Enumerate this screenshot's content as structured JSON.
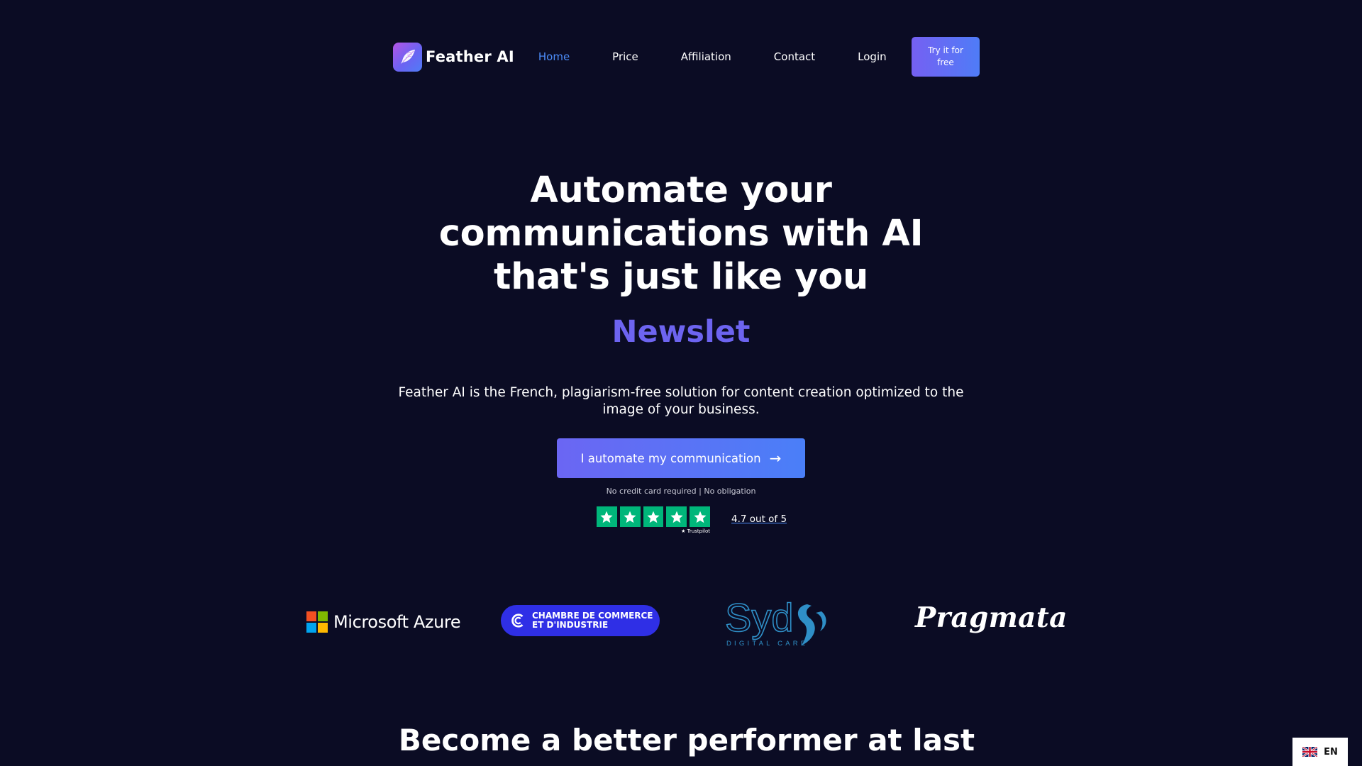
{
  "nav": {
    "brand_name": "Feather AI",
    "brand_icon": "feather-icon",
    "links": [
      {
        "label": "Home",
        "active": true
      },
      {
        "label": "Price",
        "active": false
      },
      {
        "label": "Affiliation",
        "active": false
      },
      {
        "label": "Contact",
        "active": false
      },
      {
        "label": "Login",
        "active": false
      }
    ],
    "cta_label": "Try it for free"
  },
  "hero": {
    "title": "Automate your communications with AI that's just like you",
    "typed_word": "Newslet",
    "description": "Feather AI is the French, plagiarism-free solution for content creation optimized to the image of your business.",
    "cta_label": "I automate my communication",
    "cta_icon": "arrow-right-icon",
    "note": "No credit card required | No obligation"
  },
  "rating": {
    "stars": 5,
    "provider": "Trustpilot",
    "text": "4.7 out of 5"
  },
  "partners": {
    "azure": "Microsoft Azure",
    "cci_line1": "CHAMBRE DE COMMERCE",
    "cci_line2": "ET D'INDUSTRIE",
    "syd_main": "Syd",
    "syd_sub": "DIGITAL CARE",
    "pragmata": "Pragmata"
  },
  "section": {
    "title": "Become a better performer at last"
  },
  "language": {
    "code": "EN",
    "flag_icon": "uk-flag-icon"
  },
  "colors": {
    "background": "#0b0c24",
    "accent_purple": "#6d64f0",
    "accent_blue": "#4c8cf8",
    "trustpilot_green": "#00b67a",
    "cci_blue": "#2f2fe6",
    "syd_blue": "#2f8fc7"
  }
}
